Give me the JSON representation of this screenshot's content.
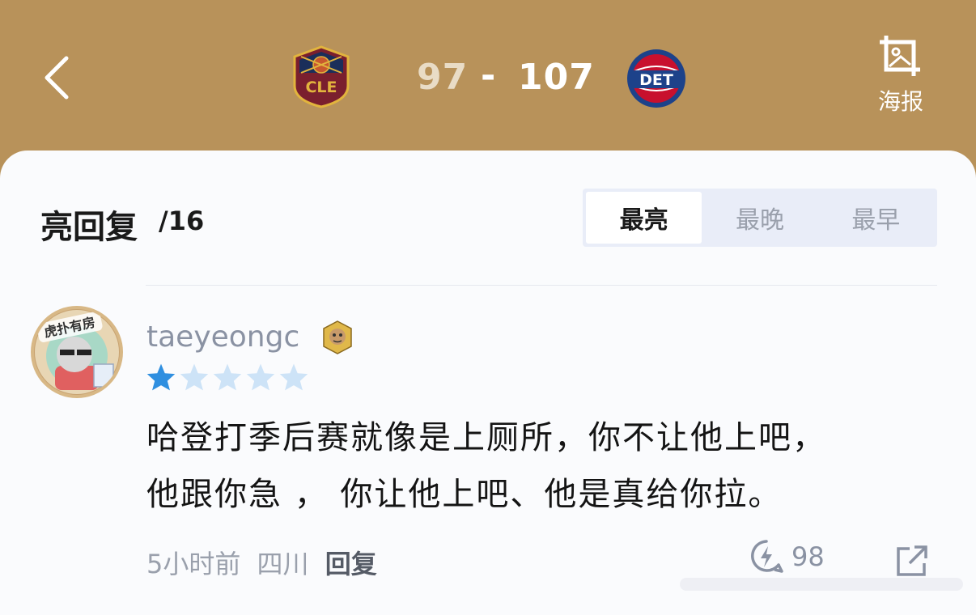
{
  "header": {
    "home_score": "97",
    "separator": "-",
    "away_score": "107",
    "home_team_logo": "CLE",
    "away_team_logo": "DET",
    "poster_label": "海报"
  },
  "section": {
    "title": "亮回复",
    "count": "/16",
    "tabs": [
      {
        "label": "最亮",
        "active": true
      },
      {
        "label": "最晚",
        "active": false
      },
      {
        "label": "最早",
        "active": false
      }
    ]
  },
  "comment": {
    "avatar_text": "虎扑有房",
    "username": "taeyeongc",
    "rating": 1,
    "rating_max": 5,
    "body_line1": "哈登打季后赛就像是上厕所，你不让他上吧，",
    "body_line2": "他跟你急 ， 你让他上吧、他是真给你拉。",
    "time": "5小时前",
    "location": "四川",
    "reply_label": "回复",
    "light_count": "98"
  },
  "colors": {
    "header_bg": "#b8925a",
    "card_bg": "#fafbfd",
    "star_filled": "#2f8fe0",
    "star_empty": "#cde3f7"
  }
}
